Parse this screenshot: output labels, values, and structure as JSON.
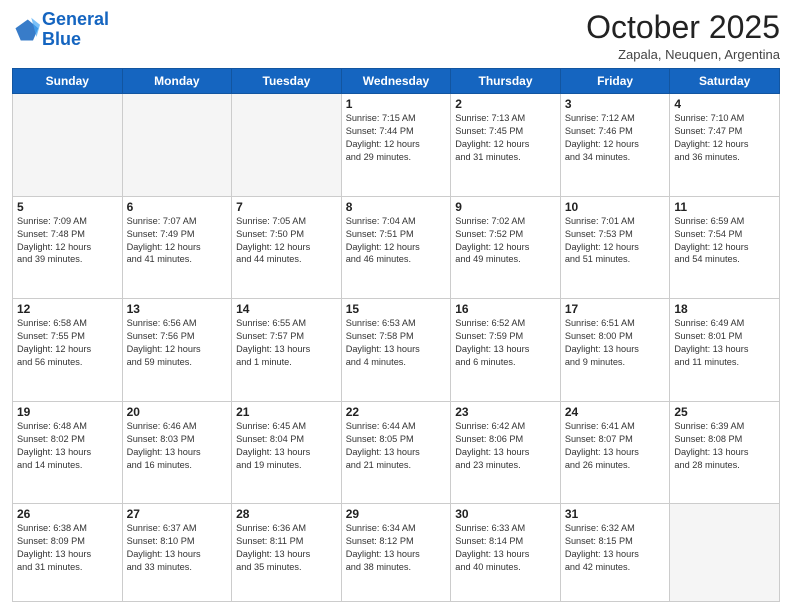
{
  "header": {
    "logo_line1": "General",
    "logo_line2": "Blue",
    "month_title": "October 2025",
    "subtitle": "Zapala, Neuquen, Argentina"
  },
  "days_of_week": [
    "Sunday",
    "Monday",
    "Tuesday",
    "Wednesday",
    "Thursday",
    "Friday",
    "Saturday"
  ],
  "weeks": [
    [
      {
        "day": "",
        "info": ""
      },
      {
        "day": "",
        "info": ""
      },
      {
        "day": "",
        "info": ""
      },
      {
        "day": "1",
        "info": "Sunrise: 7:15 AM\nSunset: 7:44 PM\nDaylight: 12 hours\nand 29 minutes."
      },
      {
        "day": "2",
        "info": "Sunrise: 7:13 AM\nSunset: 7:45 PM\nDaylight: 12 hours\nand 31 minutes."
      },
      {
        "day": "3",
        "info": "Sunrise: 7:12 AM\nSunset: 7:46 PM\nDaylight: 12 hours\nand 34 minutes."
      },
      {
        "day": "4",
        "info": "Sunrise: 7:10 AM\nSunset: 7:47 PM\nDaylight: 12 hours\nand 36 minutes."
      }
    ],
    [
      {
        "day": "5",
        "info": "Sunrise: 7:09 AM\nSunset: 7:48 PM\nDaylight: 12 hours\nand 39 minutes."
      },
      {
        "day": "6",
        "info": "Sunrise: 7:07 AM\nSunset: 7:49 PM\nDaylight: 12 hours\nand 41 minutes."
      },
      {
        "day": "7",
        "info": "Sunrise: 7:05 AM\nSunset: 7:50 PM\nDaylight: 12 hours\nand 44 minutes."
      },
      {
        "day": "8",
        "info": "Sunrise: 7:04 AM\nSunset: 7:51 PM\nDaylight: 12 hours\nand 46 minutes."
      },
      {
        "day": "9",
        "info": "Sunrise: 7:02 AM\nSunset: 7:52 PM\nDaylight: 12 hours\nand 49 minutes."
      },
      {
        "day": "10",
        "info": "Sunrise: 7:01 AM\nSunset: 7:53 PM\nDaylight: 12 hours\nand 51 minutes."
      },
      {
        "day": "11",
        "info": "Sunrise: 6:59 AM\nSunset: 7:54 PM\nDaylight: 12 hours\nand 54 minutes."
      }
    ],
    [
      {
        "day": "12",
        "info": "Sunrise: 6:58 AM\nSunset: 7:55 PM\nDaylight: 12 hours\nand 56 minutes."
      },
      {
        "day": "13",
        "info": "Sunrise: 6:56 AM\nSunset: 7:56 PM\nDaylight: 12 hours\nand 59 minutes."
      },
      {
        "day": "14",
        "info": "Sunrise: 6:55 AM\nSunset: 7:57 PM\nDaylight: 13 hours\nand 1 minute."
      },
      {
        "day": "15",
        "info": "Sunrise: 6:53 AM\nSunset: 7:58 PM\nDaylight: 13 hours\nand 4 minutes."
      },
      {
        "day": "16",
        "info": "Sunrise: 6:52 AM\nSunset: 7:59 PM\nDaylight: 13 hours\nand 6 minutes."
      },
      {
        "day": "17",
        "info": "Sunrise: 6:51 AM\nSunset: 8:00 PM\nDaylight: 13 hours\nand 9 minutes."
      },
      {
        "day": "18",
        "info": "Sunrise: 6:49 AM\nSunset: 8:01 PM\nDaylight: 13 hours\nand 11 minutes."
      }
    ],
    [
      {
        "day": "19",
        "info": "Sunrise: 6:48 AM\nSunset: 8:02 PM\nDaylight: 13 hours\nand 14 minutes."
      },
      {
        "day": "20",
        "info": "Sunrise: 6:46 AM\nSunset: 8:03 PM\nDaylight: 13 hours\nand 16 minutes."
      },
      {
        "day": "21",
        "info": "Sunrise: 6:45 AM\nSunset: 8:04 PM\nDaylight: 13 hours\nand 19 minutes."
      },
      {
        "day": "22",
        "info": "Sunrise: 6:44 AM\nSunset: 8:05 PM\nDaylight: 13 hours\nand 21 minutes."
      },
      {
        "day": "23",
        "info": "Sunrise: 6:42 AM\nSunset: 8:06 PM\nDaylight: 13 hours\nand 23 minutes."
      },
      {
        "day": "24",
        "info": "Sunrise: 6:41 AM\nSunset: 8:07 PM\nDaylight: 13 hours\nand 26 minutes."
      },
      {
        "day": "25",
        "info": "Sunrise: 6:39 AM\nSunset: 8:08 PM\nDaylight: 13 hours\nand 28 minutes."
      }
    ],
    [
      {
        "day": "26",
        "info": "Sunrise: 6:38 AM\nSunset: 8:09 PM\nDaylight: 13 hours\nand 31 minutes."
      },
      {
        "day": "27",
        "info": "Sunrise: 6:37 AM\nSunset: 8:10 PM\nDaylight: 13 hours\nand 33 minutes."
      },
      {
        "day": "28",
        "info": "Sunrise: 6:36 AM\nSunset: 8:11 PM\nDaylight: 13 hours\nand 35 minutes."
      },
      {
        "day": "29",
        "info": "Sunrise: 6:34 AM\nSunset: 8:12 PM\nDaylight: 13 hours\nand 38 minutes."
      },
      {
        "day": "30",
        "info": "Sunrise: 6:33 AM\nSunset: 8:14 PM\nDaylight: 13 hours\nand 40 minutes."
      },
      {
        "day": "31",
        "info": "Sunrise: 6:32 AM\nSunset: 8:15 PM\nDaylight: 13 hours\nand 42 minutes."
      },
      {
        "day": "",
        "info": ""
      }
    ]
  ]
}
